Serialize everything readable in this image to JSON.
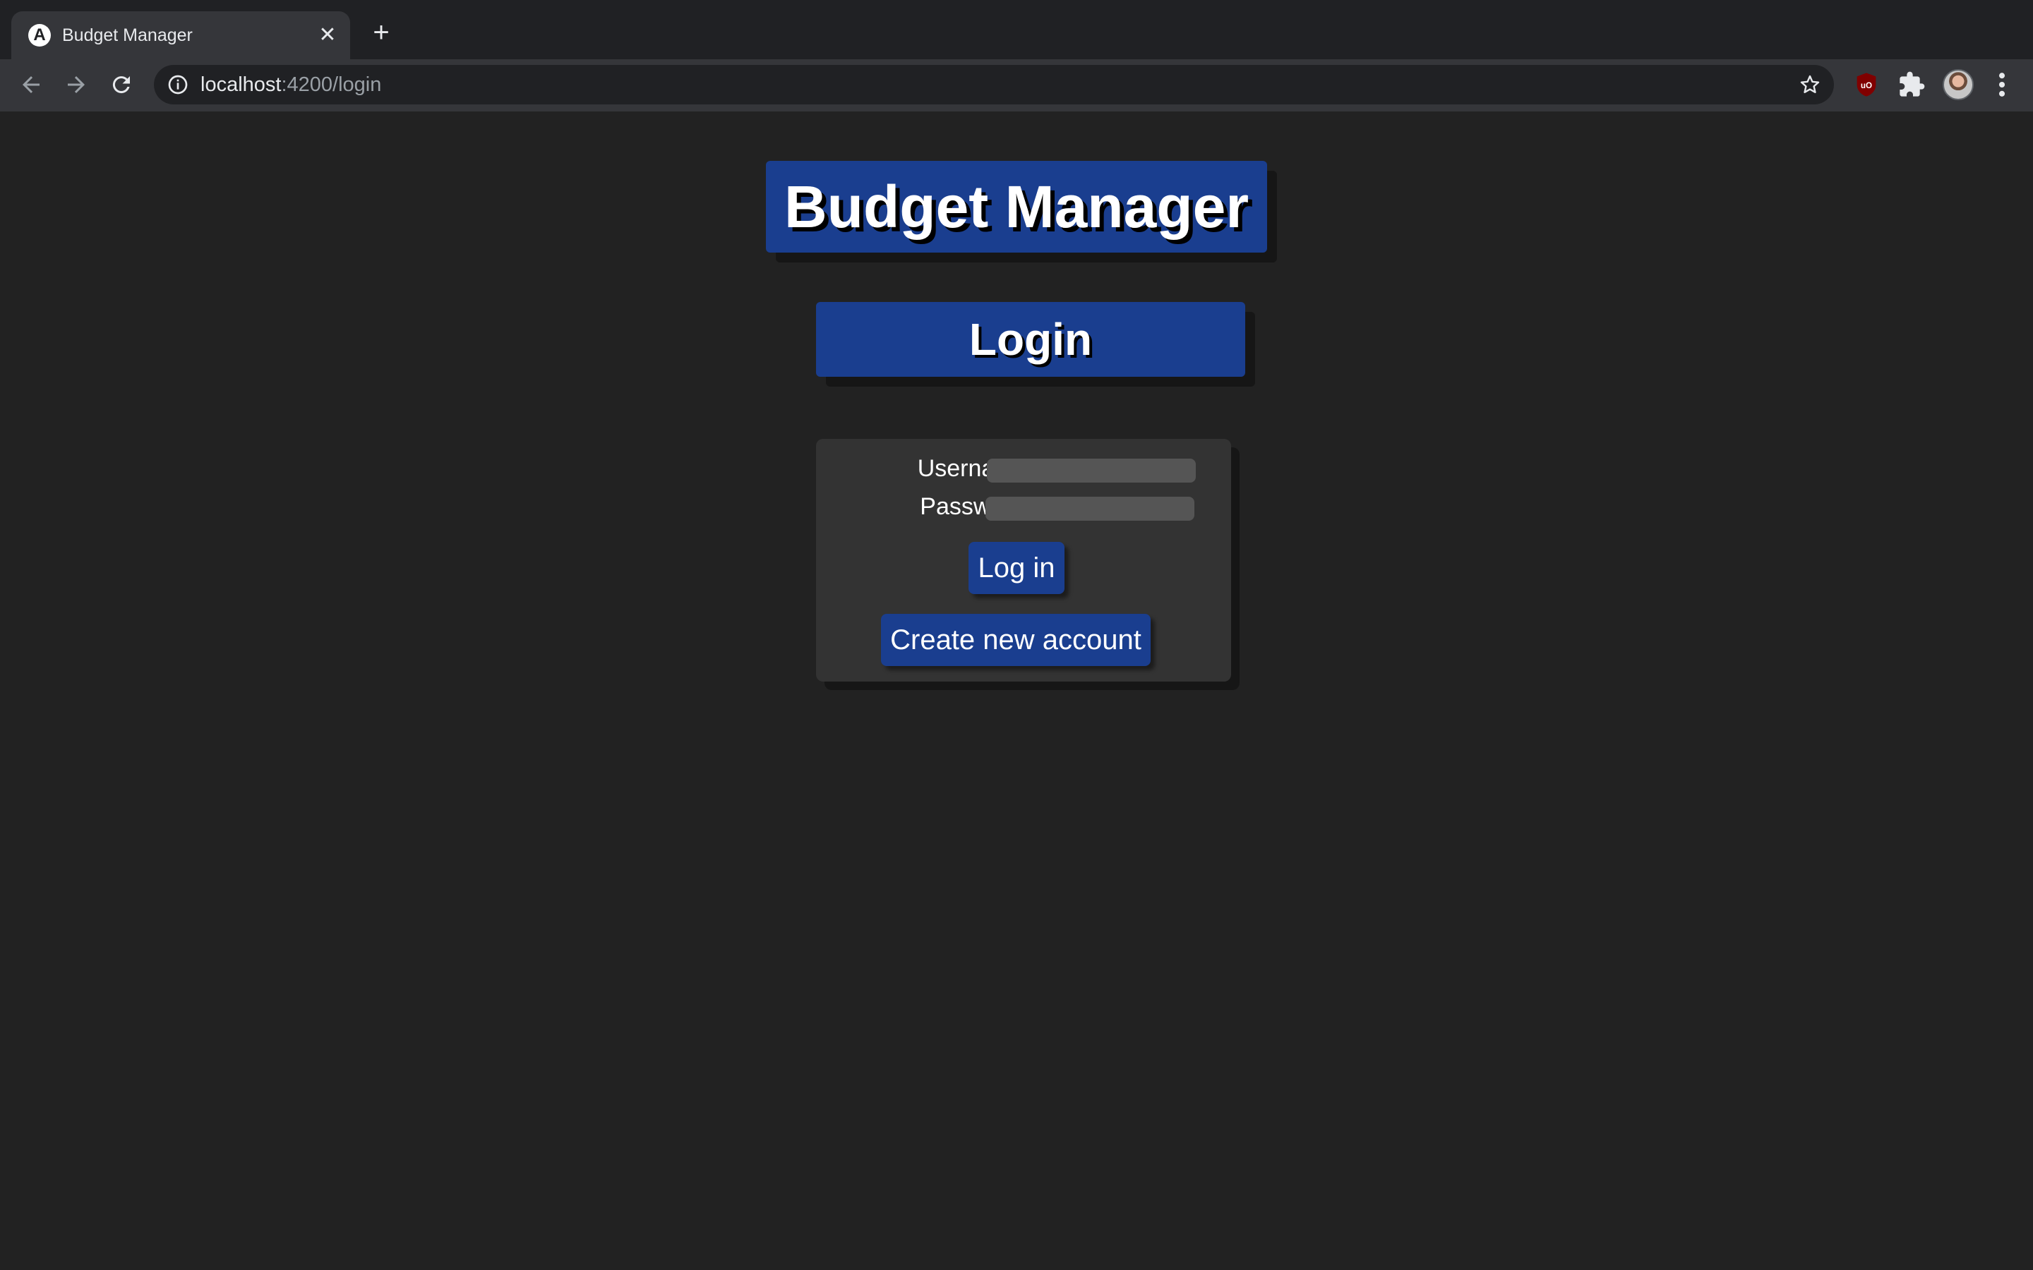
{
  "browser": {
    "tab_title": "Budget Manager",
    "tab_favicon_letter": "A",
    "url_host": "localhost",
    "url_rest": ":4200/login",
    "icons": [
      "back-icon",
      "forward-icon",
      "reload-icon",
      "info-icon",
      "star-icon",
      "ublock-icon",
      "extensions-icon",
      "avatar",
      "menu-icon"
    ]
  },
  "page": {
    "app_title": "Budget Manager",
    "section_title": "Login",
    "username_label": "Username:",
    "password_label": "Password:",
    "username_value": "",
    "password_value": "",
    "login_button": "Log in",
    "create_account_button": "Create new account"
  },
  "colors": {
    "background": "#222222",
    "accent_blue": "#1a3e8f",
    "card": "#333333",
    "input": "#555555"
  }
}
